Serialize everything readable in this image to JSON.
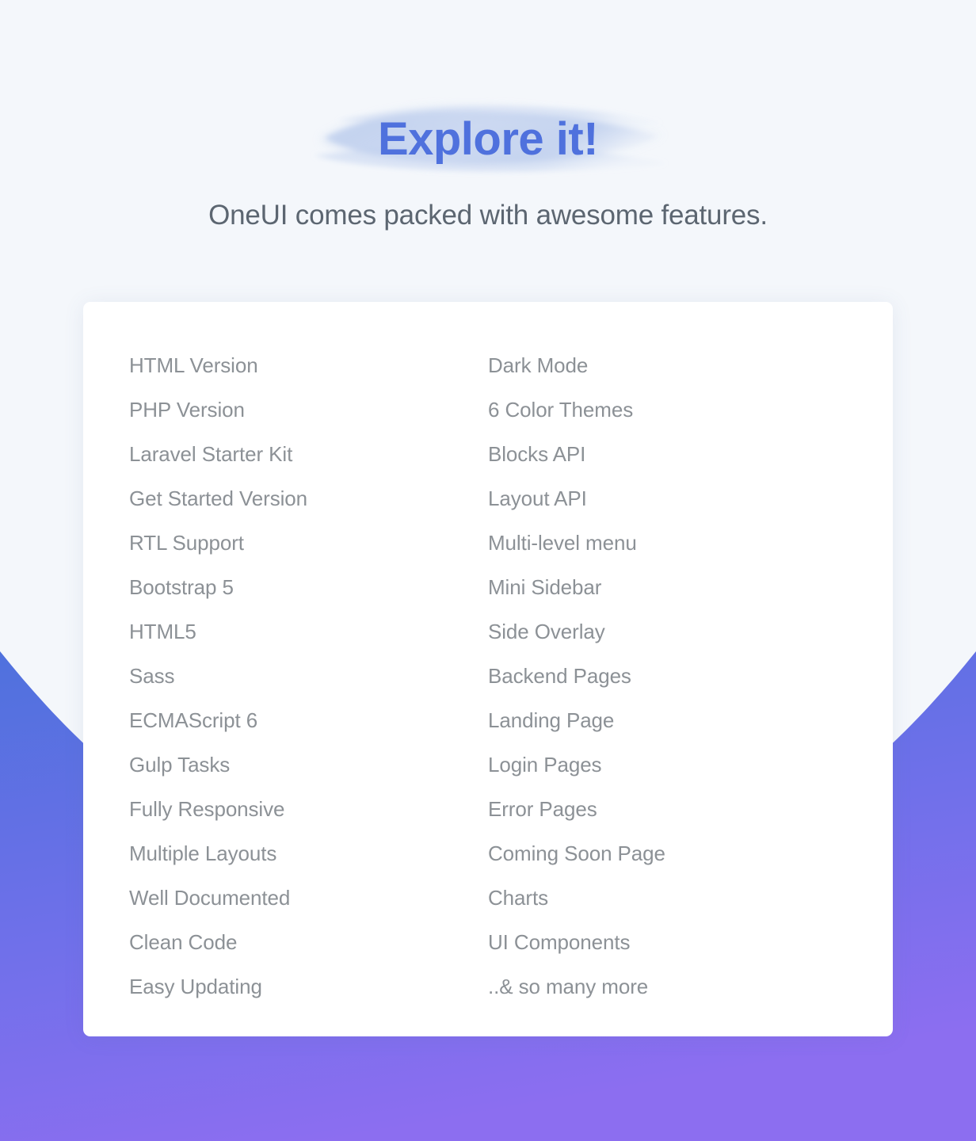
{
  "hero": {
    "title": "Explore it!",
    "subtitle": "OneUI comes packed with awesome features.",
    "title_color": "#4f71dd",
    "subtitle_color": "#5c6671",
    "brush_color": "#c5d3ef"
  },
  "theme": {
    "page_background": "#f4f7fb",
    "card_background": "#ffffff",
    "feature_text_color": "#8c9196",
    "wave_gradient_start": "#4f71dd",
    "wave_gradient_end": "#8c6ef0"
  },
  "features": {
    "left_column": [
      {
        "label": "HTML Version"
      },
      {
        "label": "PHP Version"
      },
      {
        "label": "Laravel Starter Kit"
      },
      {
        "label": "Get Started Version"
      },
      {
        "label": "RTL Support"
      },
      {
        "label": "Bootstrap 5"
      },
      {
        "label": "HTML5"
      },
      {
        "label": "Sass"
      },
      {
        "label": "ECMAScript 6"
      },
      {
        "label": "Gulp Tasks"
      },
      {
        "label": "Fully Responsive"
      },
      {
        "label": "Multiple Layouts"
      },
      {
        "label": "Well Documented"
      },
      {
        "label": "Clean Code"
      },
      {
        "label": "Easy Updating"
      }
    ],
    "right_column": [
      {
        "label": "Dark Mode"
      },
      {
        "label": "6 Color Themes"
      },
      {
        "label": "Blocks API"
      },
      {
        "label": "Layout API"
      },
      {
        "label": "Multi-level menu"
      },
      {
        "label": "Mini Sidebar"
      },
      {
        "label": "Side Overlay"
      },
      {
        "label": "Backend Pages"
      },
      {
        "label": "Landing Page"
      },
      {
        "label": "Login Pages"
      },
      {
        "label": "Error Pages"
      },
      {
        "label": "Coming Soon Page"
      },
      {
        "label": "Charts"
      },
      {
        "label": "UI Components"
      },
      {
        "label": "..& so many more"
      }
    ]
  }
}
